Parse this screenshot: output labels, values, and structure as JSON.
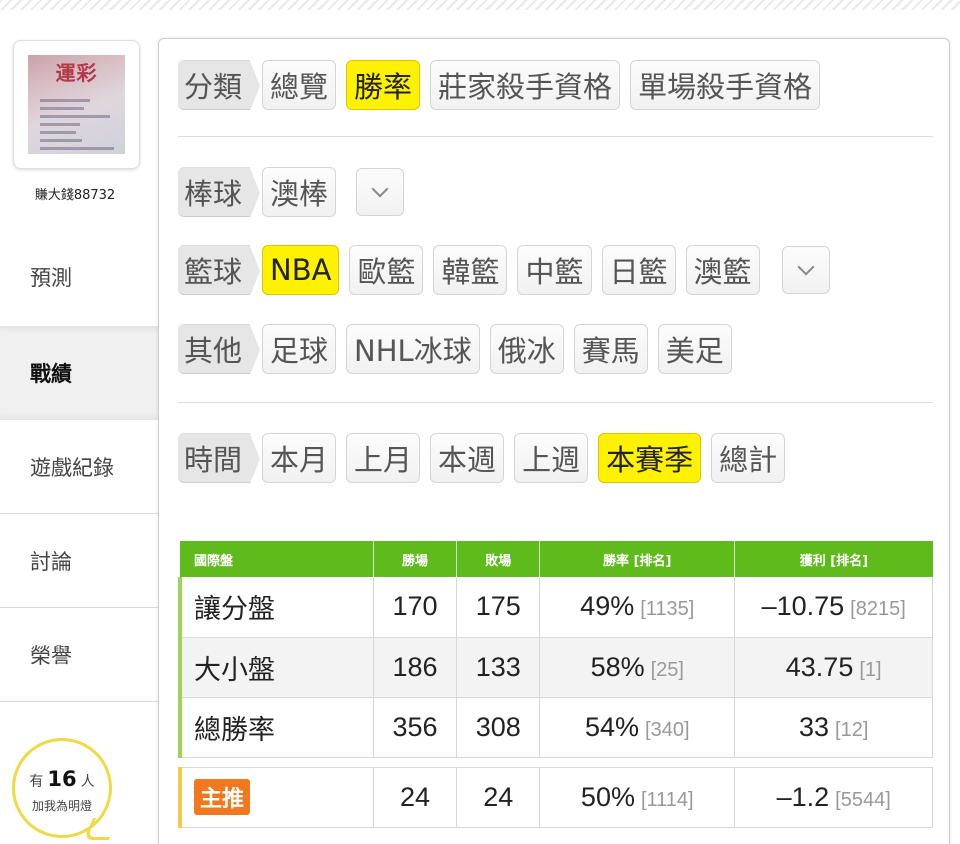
{
  "user": {
    "name": "賺大錢88732",
    "avatar_brand": "運彩"
  },
  "sidebar": {
    "items": [
      {
        "label": "預測",
        "active": false
      },
      {
        "label": "戰績",
        "active": true
      },
      {
        "label": "遊戲紀錄",
        "active": false
      },
      {
        "label": "討論",
        "active": false
      },
      {
        "label": "榮譽",
        "active": false
      }
    ],
    "fans": {
      "prefix": "有",
      "count": "16",
      "suffix": "人",
      "caption": "加我為明燈"
    }
  },
  "filters": {
    "category": {
      "label": "分類",
      "options": [
        "總覽",
        "勝率",
        "莊家殺手資格",
        "單場殺手資格"
      ],
      "selected": "勝率"
    },
    "baseball": {
      "label": "棒球",
      "options": [
        "澳棒"
      ],
      "selected": ""
    },
    "basketball": {
      "label": "籃球",
      "options": [
        "NBA",
        "歐籃",
        "韓籃",
        "中籃",
        "日籃",
        "澳籃"
      ],
      "selected": "NBA"
    },
    "other": {
      "label": "其他",
      "options": [
        "足球",
        "NHL冰球",
        "俄冰",
        "賽馬",
        "美足"
      ],
      "selected": ""
    },
    "time": {
      "label": "時間",
      "options": [
        "本月",
        "上月",
        "本週",
        "上週",
        "本賽季",
        "總計"
      ],
      "selected": "本賽季"
    }
  },
  "table": {
    "headers": [
      "國際盤",
      "勝場",
      "敗場",
      "勝率 [排名]",
      "獲利 [排名]"
    ],
    "rows": [
      {
        "name": "讓分盤",
        "win": "170",
        "loss": "175",
        "rate": "49%",
        "rate_rank": "[1135]",
        "profit": "–10.75",
        "profit_rank": "[8215]"
      },
      {
        "name": "大小盤",
        "win": "186",
        "loss": "133",
        "rate": "58%",
        "rate_rank": "[25]",
        "profit": "43.75",
        "profit_rank": "[1]"
      },
      {
        "name": "總勝率",
        "win": "356",
        "loss": "308",
        "rate": "54%",
        "rate_rank": "[340]",
        "profit": "33",
        "profit_rank": "[12]"
      }
    ],
    "pick": {
      "badge": "主推",
      "win": "24",
      "loss": "24",
      "rate": "50%",
      "rate_rank": "[1114]",
      "profit": "–1.2",
      "profit_rank": "[5544]"
    }
  },
  "colors": {
    "highlight": "#fff200",
    "header_green": "#5fba1b",
    "pick_orange": "#f0791f",
    "fans_ring": "#f2d842"
  }
}
